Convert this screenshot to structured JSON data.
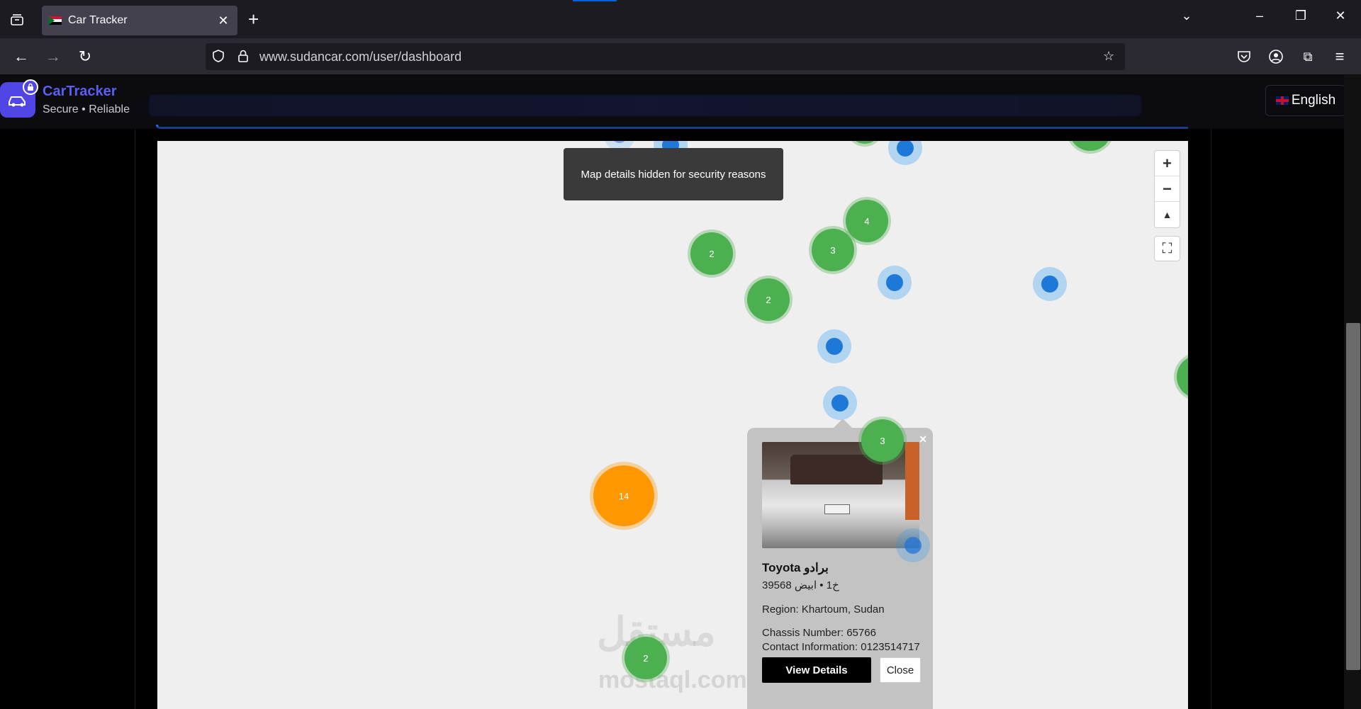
{
  "browser": {
    "tab_title": "Car Tracker",
    "url": "www.sudancar.com/user/dashboard"
  },
  "header": {
    "brand_name": "CarTracker",
    "brand_tagline": "Secure • Reliable",
    "language": "English"
  },
  "map": {
    "notice": "Map details hidden for security reasons",
    "clusters": [
      "2",
      "3",
      "4",
      "2",
      "14",
      "3",
      "2"
    ]
  },
  "popup": {
    "title": "Toyota برادو",
    "subtitle": "39568 خ1 • ابيض",
    "region": "Region: Khartoum, Sudan",
    "chassis": "Chassis Number: 65766",
    "contact": "Contact Information: 0123514717",
    "details_label": "View Details",
    "close_label": "Close"
  },
  "watermark": {
    "arabic": "مستقل",
    "latin": "mostaql.com"
  },
  "colors": {
    "brand": "#4f46e5",
    "cluster_green": "#4caf50",
    "cluster_orange": "#ff9800",
    "vehicle_blue": "#1e78d8"
  }
}
